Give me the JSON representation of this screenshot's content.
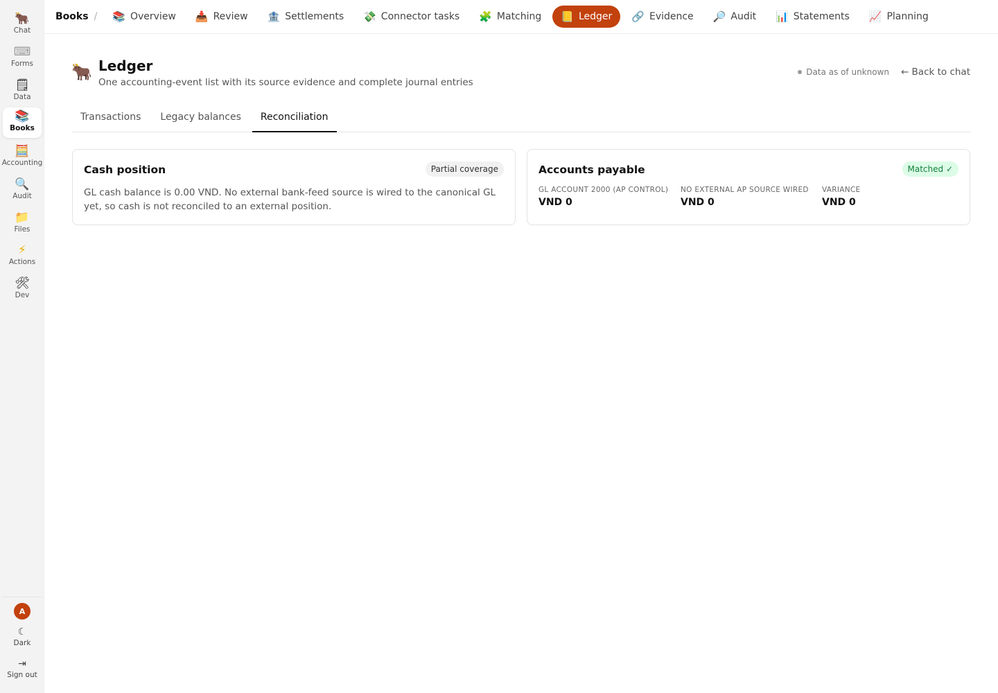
{
  "rail": {
    "items": [
      {
        "label": "Chat",
        "icon": "🐂"
      },
      {
        "label": "Forms",
        "icon": "⌨"
      },
      {
        "label": "Data",
        "icon": "🗒"
      },
      {
        "label": "Books",
        "icon": "📚"
      },
      {
        "label": "Accounting",
        "icon": "🧮"
      },
      {
        "label": "Audit",
        "icon": "🔍"
      },
      {
        "label": "Files",
        "icon": "📁"
      },
      {
        "label": "Actions",
        "icon": "⚡"
      },
      {
        "label": "Dev",
        "icon": "🛠"
      }
    ],
    "active": "Books",
    "avatar_initial": "A",
    "dark_label": "Dark",
    "dark_icon": "☾",
    "signout_label": "Sign out",
    "signout_icon": "⇥"
  },
  "topnav": {
    "breadcrumb": "Books",
    "separator": "/",
    "tabs": [
      {
        "label": "Overview",
        "icon": "📚"
      },
      {
        "label": "Review",
        "icon": "📥"
      },
      {
        "label": "Settlements",
        "icon": "🏦"
      },
      {
        "label": "Connector tasks",
        "icon": "💸"
      },
      {
        "label": "Matching",
        "icon": "🧩"
      },
      {
        "label": "Ledger",
        "icon": "📒"
      },
      {
        "label": "Evidence",
        "icon": "🔗"
      },
      {
        "label": "Audit",
        "icon": "🔎"
      },
      {
        "label": "Statements",
        "icon": "📊"
      },
      {
        "label": "Planning",
        "icon": "📈"
      }
    ],
    "active": "Ledger",
    "accent_color": "#c2410c"
  },
  "header": {
    "icon": "🐂",
    "title": "Ledger",
    "subtitle": "One accounting-event list with its source evidence and complete journal entries",
    "freshness": "Data as of unknown",
    "back_link": "← Back to chat"
  },
  "subtabs": {
    "items": [
      "Transactions",
      "Legacy balances",
      "Reconciliation"
    ],
    "active": "Reconciliation"
  },
  "cards": {
    "cash": {
      "title": "Cash position",
      "badge": "Partial coverage",
      "text": "GL cash balance is 0.00 VND. No external bank-feed source is wired to the canonical GL yet, so cash is not reconciled to an external position."
    },
    "ap": {
      "title": "Accounts payable",
      "badge": "Matched ✓",
      "badge_color": "#15803d",
      "metrics": [
        {
          "label": "GL ACCOUNT 2000 (AP CONTROL)",
          "value": "VND 0"
        },
        {
          "label": "NO EXTERNAL AP SOURCE WIRED",
          "value": "VND 0"
        },
        {
          "label": "VARIANCE",
          "value": "VND 0"
        }
      ]
    }
  }
}
